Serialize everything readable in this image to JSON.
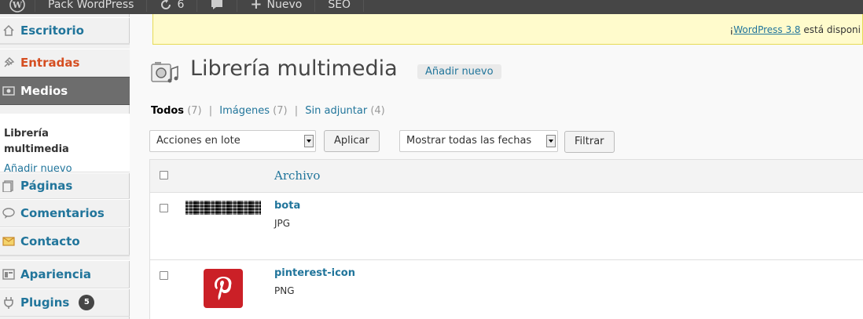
{
  "adminbar": {
    "site_name": "Pack WordPress",
    "updates_count": "6",
    "new_label": "Nuevo",
    "seo_label": "SEO"
  },
  "sidebar": {
    "items": [
      {
        "label": "Escritorio",
        "icon": "home-icon"
      },
      {
        "label": "Entradas",
        "icon": "pin-icon"
      },
      {
        "label": "Medios",
        "icon": "media-icon"
      },
      {
        "label": "Páginas",
        "icon": "pages-icon"
      },
      {
        "label": "Comentarios",
        "icon": "comment-icon"
      },
      {
        "label": "Contacto",
        "icon": "contact-icon"
      },
      {
        "label": "Apariencia",
        "icon": "appearance-icon"
      },
      {
        "label": "Plugins",
        "icon": "plugin-icon",
        "badge": "5"
      }
    ],
    "submenu": {
      "current": "Librería multimedia",
      "add_new": "Añadir nuevo"
    }
  },
  "notice": {
    "prefix": "¡",
    "link": "WordPress 3.8",
    "suffix": " está disponi"
  },
  "page": {
    "title": "Librería multimedia",
    "add_new": "Añadir nuevo"
  },
  "filters": {
    "all": {
      "label": "Todos",
      "count": "(7)"
    },
    "images": {
      "label": "Imágenes",
      "count": "(7)"
    },
    "unattached": {
      "label": "Sin adjuntar",
      "count": "(4)"
    },
    "separator": "|"
  },
  "toolbar": {
    "bulk_select": "Acciones en lote",
    "apply": "Aplicar",
    "dates_select": "Mostrar todas las fechas",
    "filter": "Filtrar"
  },
  "table": {
    "column_file": "Archivo",
    "rows": [
      {
        "title": "bota",
        "type": "JPG"
      },
      {
        "title": "pinterest-icon",
        "type": "PNG"
      }
    ]
  },
  "colors": {
    "link": "#21759b",
    "active_menu": "#d54e21",
    "notice_bg": "#fffbcc",
    "pinterest": "#cb2027"
  }
}
